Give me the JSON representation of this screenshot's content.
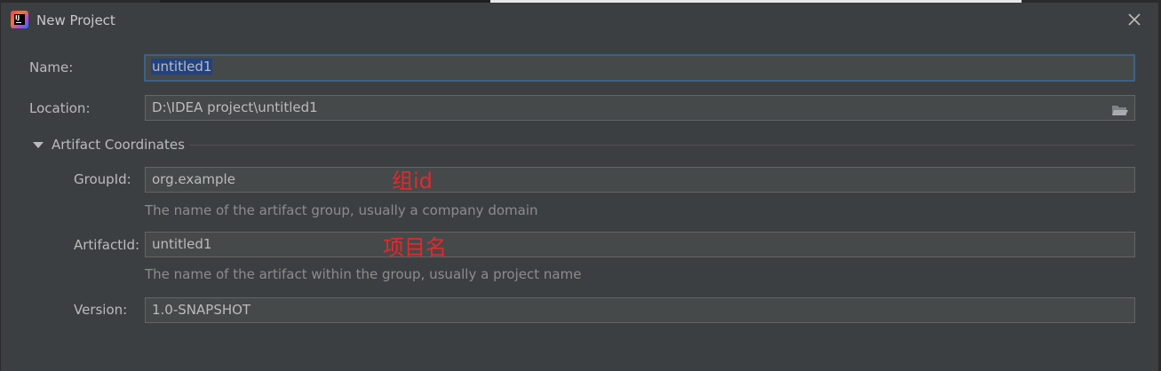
{
  "window": {
    "title": "New Project"
  },
  "form": {
    "name": {
      "label": "Name:",
      "value": "untitled1"
    },
    "location": {
      "label": "Location:",
      "value": "D:\\IDEA project\\untitled1"
    },
    "artifact_section": {
      "title": "Artifact Coordinates",
      "expanded": true
    },
    "group_id": {
      "label": "GroupId:",
      "value": "org.example",
      "hint": "The name of the artifact group, usually a company domain"
    },
    "artifact_id": {
      "label": "ArtifactId:",
      "value": "untitled1",
      "hint": "The name of the artifact within the group, usually a project name"
    },
    "version": {
      "label": "Version:",
      "value": "1.0-SNAPSHOT"
    }
  },
  "annotations": {
    "group_note": "组id",
    "artifact_note": "项目名"
  },
  "icons": {
    "app": "intellij-idea-icon",
    "close": "close-icon",
    "folder": "folder-icon",
    "expand": "triangle-down-icon"
  },
  "colors": {
    "background": "#3c3f41",
    "field_bg": "#45494a",
    "focus_border": "#3d6185",
    "selection": "#214283",
    "annotation": "#e8262b"
  }
}
